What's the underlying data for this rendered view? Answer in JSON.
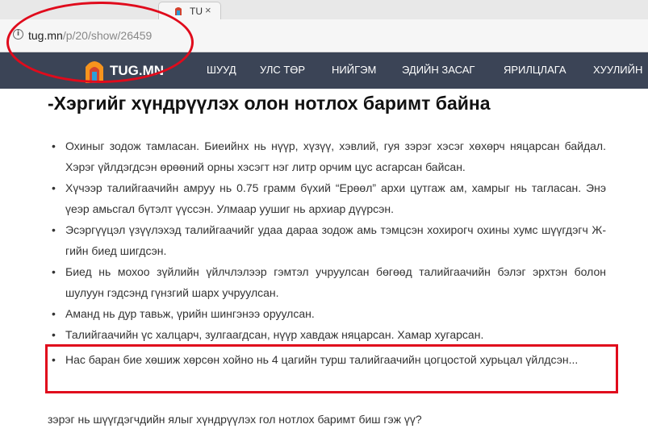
{
  "browser": {
    "tab_title": "TU",
    "tab_close": "×",
    "url_host": "tug.mn",
    "url_path": "/p/20/show/26459",
    "info_icon": "info-icon"
  },
  "site": {
    "logo_text": "TUG.MN",
    "nav": [
      "ШУУД",
      "УЛС ТӨР",
      "НИЙГЭМ",
      "ЭДИЙН ЗАСАГ",
      "ЯРИЛЦЛАГА",
      "ХУУЛИЙН"
    ]
  },
  "article": {
    "title": "-Хэргийг хүндрүүлэх олон нотлох баримт байна",
    "bullets": [
      "Охиныг зодож тамласан. Биеийнх нь нүүр, хүзүү, хэвлий, гуя зэрэг хэсэг хөхөрч няцарсан байдал. Хэрэг үйлдэгдсэн өрөөний орны хэсэгт нэг литр орчим цус асгарсан байсан.",
      "Хүчээр талийгаачийн амруу нь 0.75 грамм бүхий “Ерөөл” архи цутгаж ам, хамрыг нь тагласан. Энэ үеэр амьсгал бүтэлт үүссэн. Улмаар уушиг нь архиар дүүрсэн.",
      "Эсэргүүцэл үзүүлэхэд талийгаачийг удаа дараа зодож амь тэмцсэн хохирогч охины хумс шүүгдэгч Ж-гийн биед шигдсэн.",
      "Биед нь мохоо зүйлийн үйлчлэлээр гэмтэл учруулсан бөгөөд талийгаачийн бэлэг эрхтэн болон шулуун гэдсэнд гүнзгий шарх учруулсан.",
      "Аманд нь дур тавьж, үрийн шингэнээ оруулсан.",
      "Талийгаачийн үс халцарч, зулгаагдсан, нүүр хавдаж няцарсан. Хамар хугарсан.",
      "Нас баран бие хөшиж хөрсөн хойно нь 4 цагийн турш талийгаачийн цогцостой хурьцал үйлдсэн..."
    ],
    "question": "зэрэг нь шүүгдэгчдийн ялыг хүндрүүлэх гол нотлох баримт биш гэж үү?"
  },
  "colors": {
    "nav_bg": "#3b4456",
    "annotation_red": "#e00b1c",
    "logo_orange": "#f7941d",
    "logo_blue": "#2b9fd9"
  }
}
